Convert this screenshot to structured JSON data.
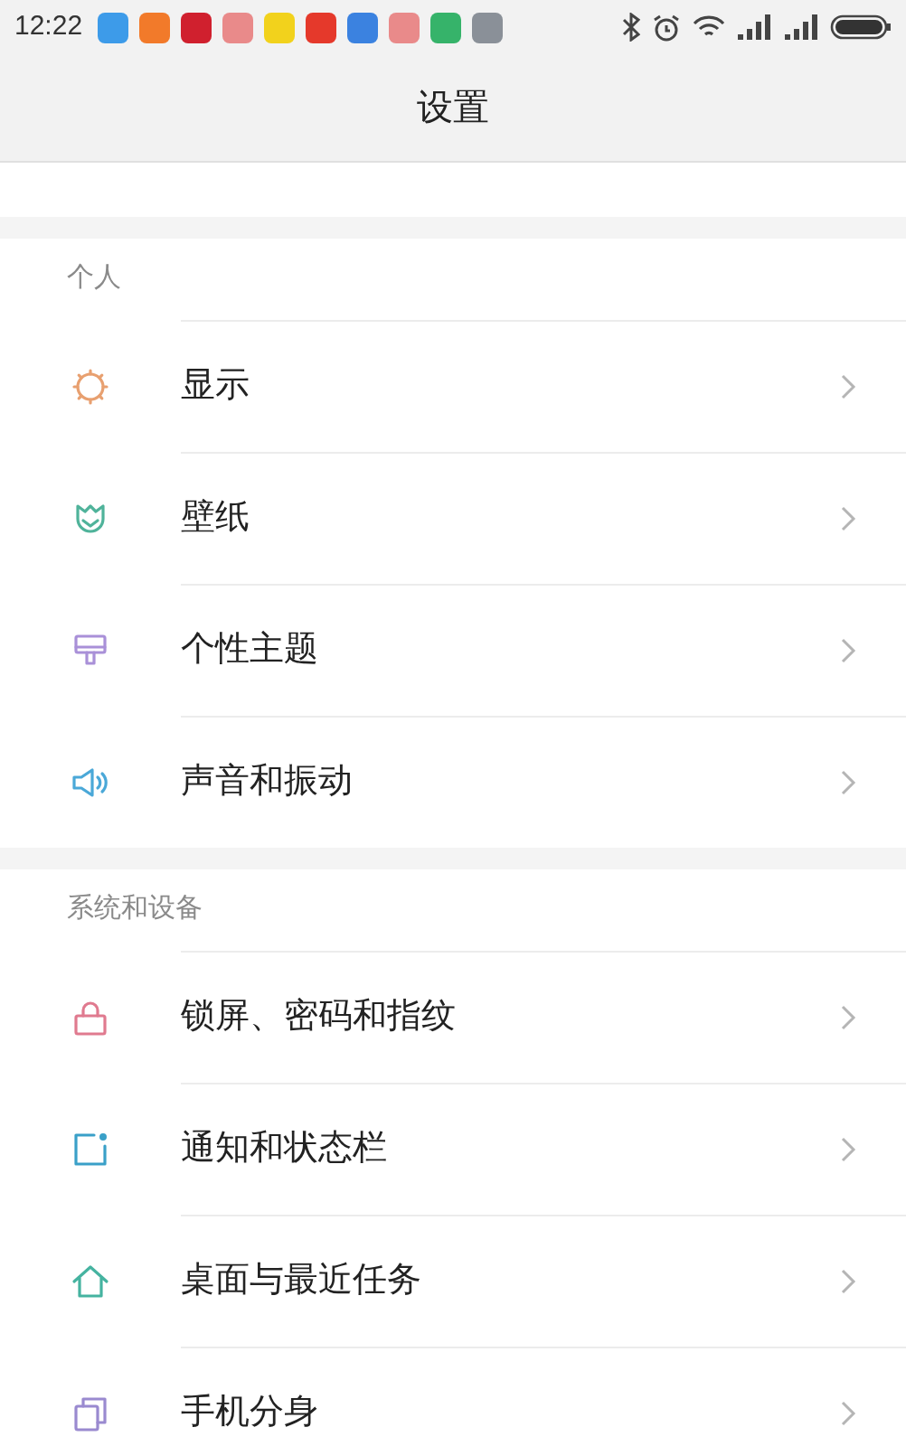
{
  "status_bar": {
    "time": "12:22",
    "app_icons": [
      {
        "color": "#3d9be9"
      },
      {
        "color": "#f27a2a"
      },
      {
        "color": "#d0202e"
      },
      {
        "color": "#e98a8a"
      },
      {
        "color": "#f2d21c"
      },
      {
        "color": "#e5392b"
      },
      {
        "color": "#3b82e0"
      },
      {
        "color": "#e98a8a"
      },
      {
        "color": "#36b36a"
      },
      {
        "color": "#8a9098"
      }
    ]
  },
  "header": {
    "title": "设置"
  },
  "sections": [
    {
      "title": "个人",
      "items": [
        {
          "label": "显示",
          "kind": "sun",
          "color": "#e8a070"
        },
        {
          "label": "壁纸",
          "kind": "tulip",
          "color": "#4fb39a"
        },
        {
          "label": "个性主题",
          "kind": "brush",
          "color": "#a990d8"
        },
        {
          "label": "声音和振动",
          "kind": "speaker",
          "color": "#4aa8d8"
        }
      ]
    },
    {
      "title": "系统和设备",
      "items": [
        {
          "label": "锁屏、密码和指纹",
          "kind": "lock",
          "color": "#e07a8f"
        },
        {
          "label": "通知和状态栏",
          "kind": "notification",
          "color": "#3aa0c8"
        },
        {
          "label": "桌面与最近任务",
          "kind": "home",
          "color": "#45b3a0"
        },
        {
          "label": "手机分身",
          "kind": "copy",
          "color": "#9a8ad0"
        }
      ]
    }
  ]
}
